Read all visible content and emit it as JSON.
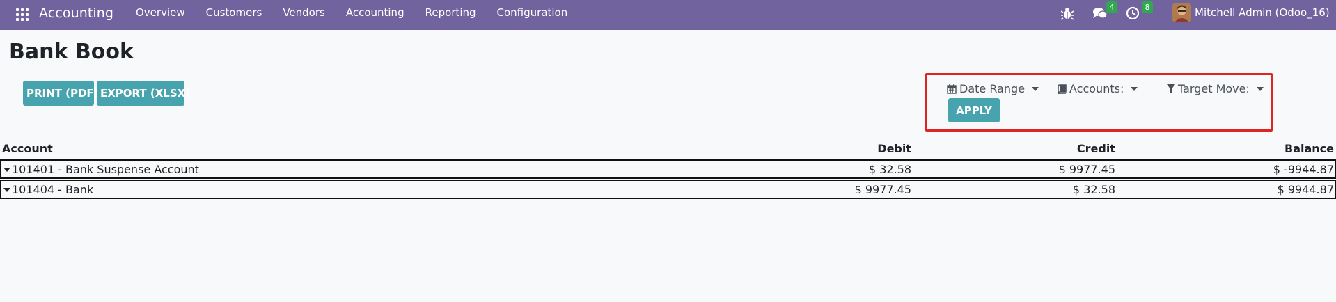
{
  "navbar": {
    "brand": "Accounting",
    "menu": [
      "Overview",
      "Customers",
      "Vendors",
      "Accounting",
      "Reporting",
      "Configuration"
    ],
    "chat_count": "4",
    "activity_count": "8",
    "user": "Mitchell Admin (Odoo_16)",
    "icons": [
      "apps-grid-icon",
      "bug-icon",
      "chat-icon",
      "clock-icon"
    ],
    "color": "#71639e"
  },
  "page": {
    "title": "Bank Book",
    "print_label": "PRINT (PDF)",
    "export_label": "EXPORT (XLSX)"
  },
  "filters": {
    "date_range": "Date Range",
    "accounts": "Accounts:",
    "target_move": "Target Move:",
    "apply_label": "APPLY",
    "highlight_color": "#e02424"
  },
  "table": {
    "headers": {
      "account": "Account",
      "debit": "Debit",
      "credit": "Credit",
      "balance": "Balance"
    },
    "rows": [
      {
        "account": "101401 - Bank Suspense Account",
        "debit": "$ 32.58",
        "credit": "$ 9977.45",
        "balance": "$ -9944.87"
      },
      {
        "account": "101404 - Bank",
        "debit": "$ 9977.45",
        "credit": "$ 32.58",
        "balance": "$ 9944.87"
      }
    ]
  },
  "accent_color": "#47a3ad"
}
